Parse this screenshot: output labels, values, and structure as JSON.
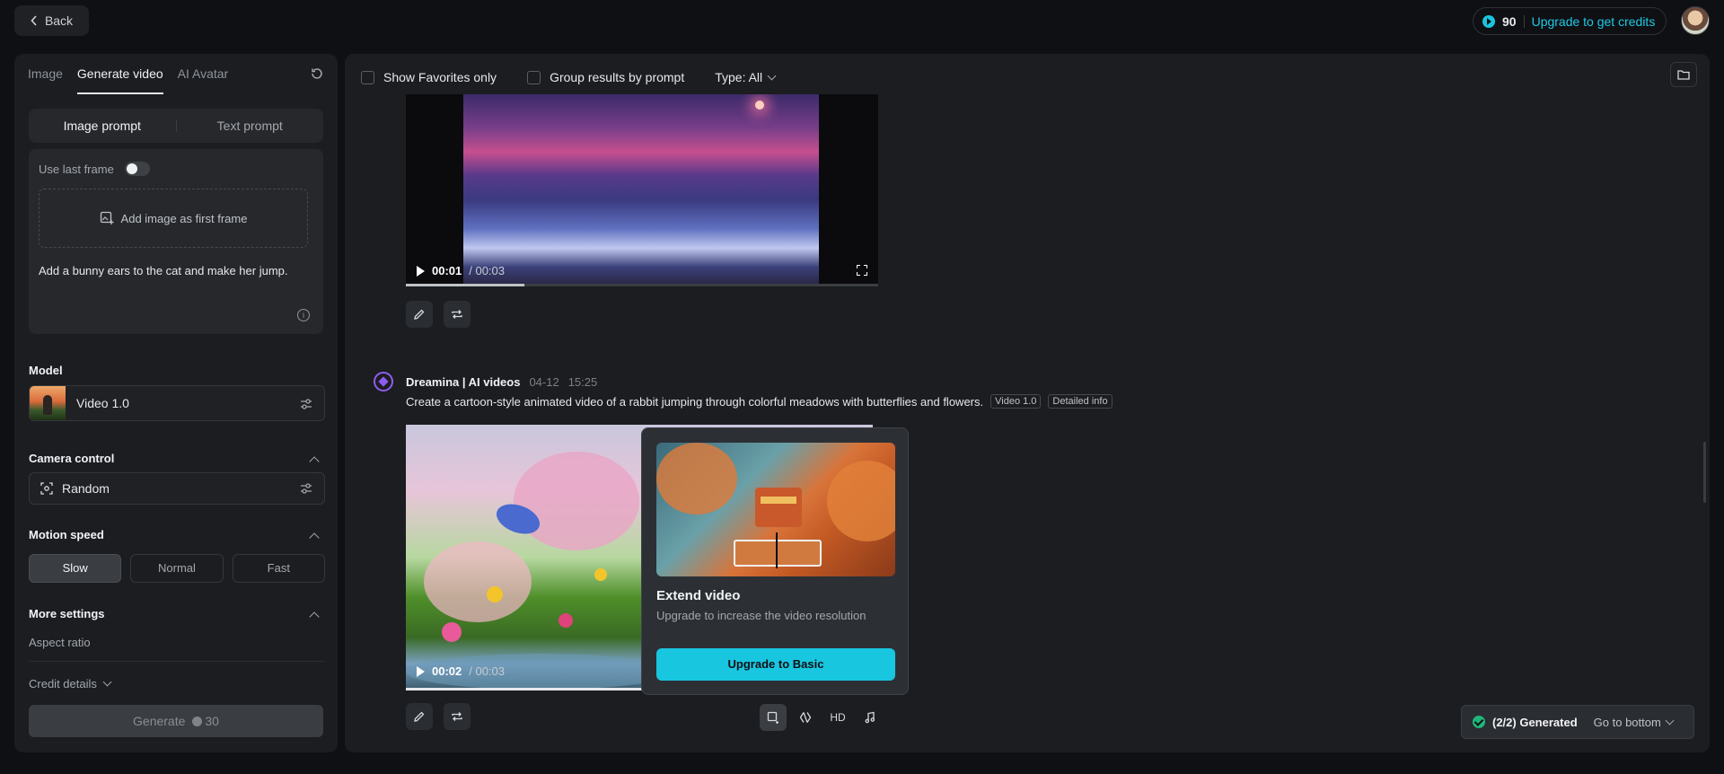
{
  "topbar": {
    "back_label": "Back",
    "credits_count": "90",
    "upgrade_label": "Upgrade to get credits"
  },
  "left": {
    "tabs": [
      "Image",
      "Generate video",
      "AI Avatar"
    ],
    "prompt_modes": [
      "Image prompt",
      "Text prompt"
    ],
    "use_last_frame_label": "Use last frame",
    "add_image_label": "Add image as first frame",
    "prompt_text": "Add a bunny ears to the cat and make her jump.",
    "model_title": "Model",
    "model_name": "Video 1.0",
    "camera_title": "Camera control",
    "camera_value": "Random",
    "motion_title": "Motion speed",
    "motion_options": [
      "Slow",
      "Normal",
      "Fast"
    ],
    "motion_selected": "Slow",
    "more_title": "More settings",
    "aspect_label": "Aspect ratio",
    "credit_details": "Credit details",
    "generate_label": "Generate",
    "generate_cost": "30"
  },
  "filters": {
    "favorites": "Show Favorites only",
    "group": "Group results by prompt",
    "type": "Type: All"
  },
  "video1": {
    "current": "00:01",
    "total": "/ 00:03",
    "progress": 0.25
  },
  "generation": {
    "author": "Dreamina | AI videos",
    "date": "04-12",
    "time": "15:25",
    "prompt": "Create a cartoon-style animated video of a rabbit jumping through colorful meadows with butterflies and flowers.",
    "tags": [
      "Video 1.0",
      "Detailed info"
    ],
    "current": "00:02",
    "total": "/ 00:03",
    "progress": 0.66
  },
  "popover": {
    "title": "Extend video",
    "subtitle": "Upgrade to increase the video resolution",
    "button": "Upgrade to Basic"
  },
  "tools": {
    "hd_label": "HD"
  },
  "toast": {
    "count": "(2/2) Generated",
    "link": "Go to bottom"
  },
  "colors": {
    "accent": "#19c6e0",
    "success": "#1fb57a",
    "brand_logo": "#8f5cf0"
  }
}
